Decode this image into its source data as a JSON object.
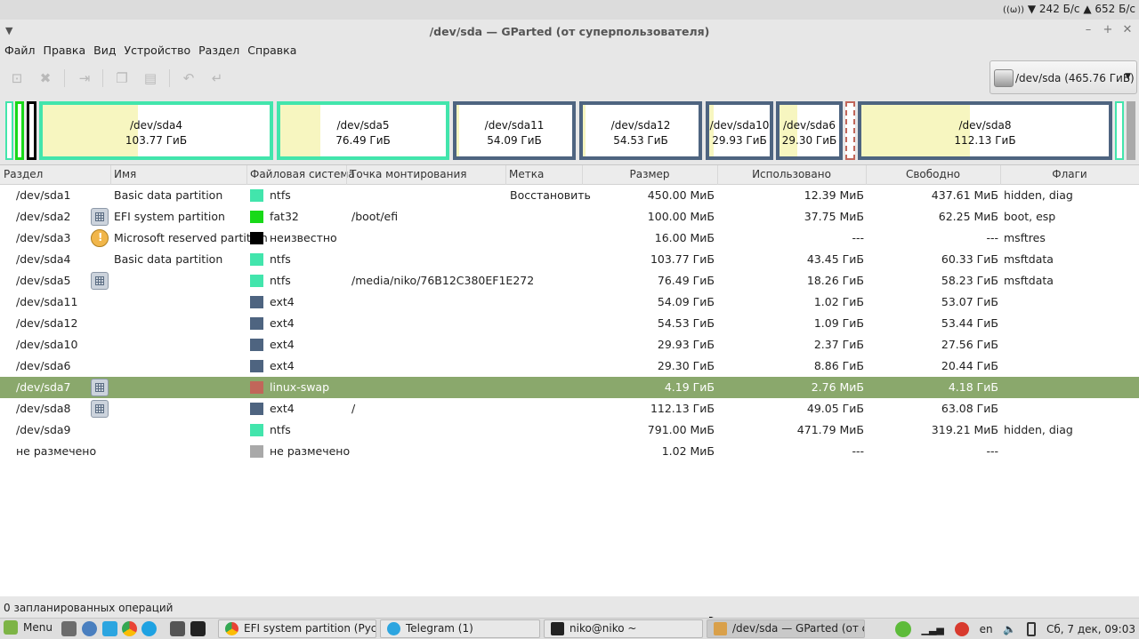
{
  "top_panel": {
    "net_down": "242 Б/с",
    "net_up": "652 Б/с"
  },
  "window": {
    "title": "/dev/sda — GParted (от суперпользователя)"
  },
  "menubar": [
    "Файл",
    "Правка",
    "Вид",
    "Устройство",
    "Раздел",
    "Справка"
  ],
  "device_selector": {
    "label": "/dev/sda  (465.76 ГиБ)"
  },
  "partition_map": [
    {
      "name": "/dev/sda4",
      "size": "103.77 ГиБ"
    },
    {
      "name": "/dev/sda5",
      "size": "76.49 ГиБ"
    },
    {
      "name": "/dev/sda11",
      "size": "54.09 ГиБ"
    },
    {
      "name": "/dev/sda12",
      "size": "54.53 ГиБ"
    },
    {
      "name": "/dev/sda10",
      "size": "29.93 ГиБ"
    },
    {
      "name": "/dev/sda6",
      "size": "29.30 ГиБ"
    },
    {
      "name": "/dev/sda8",
      "size": "112.13 ГиБ"
    }
  ],
  "table": {
    "headers": [
      "Раздел",
      "Имя",
      "Файловая система",
      "Точка монтирования",
      "Метка",
      "Размер",
      "Использовано",
      "Свободно",
      "Флаги"
    ],
    "rows": [
      {
        "partition": "/dev/sda1",
        "name": "Basic data partition",
        "fs": "ntfs",
        "mount": "",
        "label": "Восстановить",
        "size": "450.00 МиБ",
        "used": "12.39 МиБ",
        "free": "437.61 МиБ",
        "flags": "hidden, diag",
        "fs_color": "#42e5ac",
        "icon": ""
      },
      {
        "partition": "/dev/sda2",
        "name": "EFI system partition",
        "fs": "fat32",
        "mount": "/boot/efi",
        "label": "",
        "size": "100.00 МиБ",
        "used": "37.75 МиБ",
        "free": "62.25 МиБ",
        "flags": "boot, esp",
        "fs_color": "#18d918",
        "icon": "lock"
      },
      {
        "partition": "/dev/sda3",
        "name": "Microsoft reserved partition",
        "fs": "неизвестно",
        "mount": "",
        "label": "",
        "size": "16.00 МиБ",
        "used": "---",
        "free": "---",
        "flags": "msftres",
        "fs_color": "#000000",
        "icon": "warning"
      },
      {
        "partition": "/dev/sda4",
        "name": "Basic data partition",
        "fs": "ntfs",
        "mount": "",
        "label": "",
        "size": "103.77 ГиБ",
        "used": "43.45 ГиБ",
        "free": "60.33 ГиБ",
        "flags": "msftdata",
        "fs_color": "#42e5ac",
        "icon": ""
      },
      {
        "partition": "/dev/sda5",
        "name": "",
        "fs": "ntfs",
        "mount": "/media/niko/76B12C380EF1E272",
        "label": "",
        "size": "76.49 ГиБ",
        "used": "18.26 ГиБ",
        "free": "58.23 ГиБ",
        "flags": "msftdata",
        "fs_color": "#42e5ac",
        "icon": "lock"
      },
      {
        "partition": "/dev/sda11",
        "name": "",
        "fs": "ext4",
        "mount": "",
        "label": "",
        "size": "54.09 ГиБ",
        "used": "1.02 ГиБ",
        "free": "53.07 ГиБ",
        "flags": "",
        "fs_color": "#4e6480",
        "icon": ""
      },
      {
        "partition": "/dev/sda12",
        "name": "",
        "fs": "ext4",
        "mount": "",
        "label": "",
        "size": "54.53 ГиБ",
        "used": "1.09 ГиБ",
        "free": "53.44 ГиБ",
        "flags": "",
        "fs_color": "#4e6480",
        "icon": ""
      },
      {
        "partition": "/dev/sda10",
        "name": "",
        "fs": "ext4",
        "mount": "",
        "label": "",
        "size": "29.93 ГиБ",
        "used": "2.37 ГиБ",
        "free": "27.56 ГиБ",
        "flags": "",
        "fs_color": "#4e6480",
        "icon": ""
      },
      {
        "partition": "/dev/sda6",
        "name": "",
        "fs": "ext4",
        "mount": "",
        "label": "",
        "size": "29.30 ГиБ",
        "used": "8.86 ГиБ",
        "free": "20.44 ГиБ",
        "flags": "",
        "fs_color": "#4e6480",
        "icon": ""
      },
      {
        "partition": "/dev/sda7",
        "name": "",
        "fs": "linux-swap",
        "mount": "",
        "label": "",
        "size": "4.19 ГиБ",
        "used": "2.76 МиБ",
        "free": "4.18 ГиБ",
        "flags": "",
        "fs_color": "#c1665a",
        "icon": "lock",
        "selected": true
      },
      {
        "partition": "/dev/sda8",
        "name": "",
        "fs": "ext4",
        "mount": "/",
        "label": "",
        "size": "112.13 ГиБ",
        "used": "49.05 ГиБ",
        "free": "63.08 ГиБ",
        "flags": "",
        "fs_color": "#4e6480",
        "icon": "lock"
      },
      {
        "partition": "/dev/sda9",
        "name": "",
        "fs": "ntfs",
        "mount": "",
        "label": "",
        "size": "791.00 МиБ",
        "used": "471.79 МиБ",
        "free": "319.21 МиБ",
        "flags": "hidden, diag",
        "fs_color": "#42e5ac",
        "icon": ""
      },
      {
        "partition": "не размечено",
        "name": "",
        "fs": "не размечено",
        "mount": "",
        "label": "",
        "size": "1.02 МиБ",
        "used": "---",
        "free": "---",
        "flags": "",
        "fs_color": "#a9a9a9",
        "icon": ""
      }
    ]
  },
  "status": "0 запланированных операций",
  "taskbar": {
    "menu_label": "Menu",
    "tasks": [
      {
        "label": "EFI system partition (Русс...",
        "icon_color": "#e94335"
      },
      {
        "label": "Telegram (1)",
        "icon_color": "#2ca5e0"
      },
      {
        "label": "niko@niko ~",
        "icon_color": "#222222"
      },
      {
        "label": "/dev/sda — GParted (от с...",
        "icon_color": "#d9a04a"
      }
    ],
    "lang": "en",
    "clock": "Сб, 7 дек, 09:03"
  }
}
